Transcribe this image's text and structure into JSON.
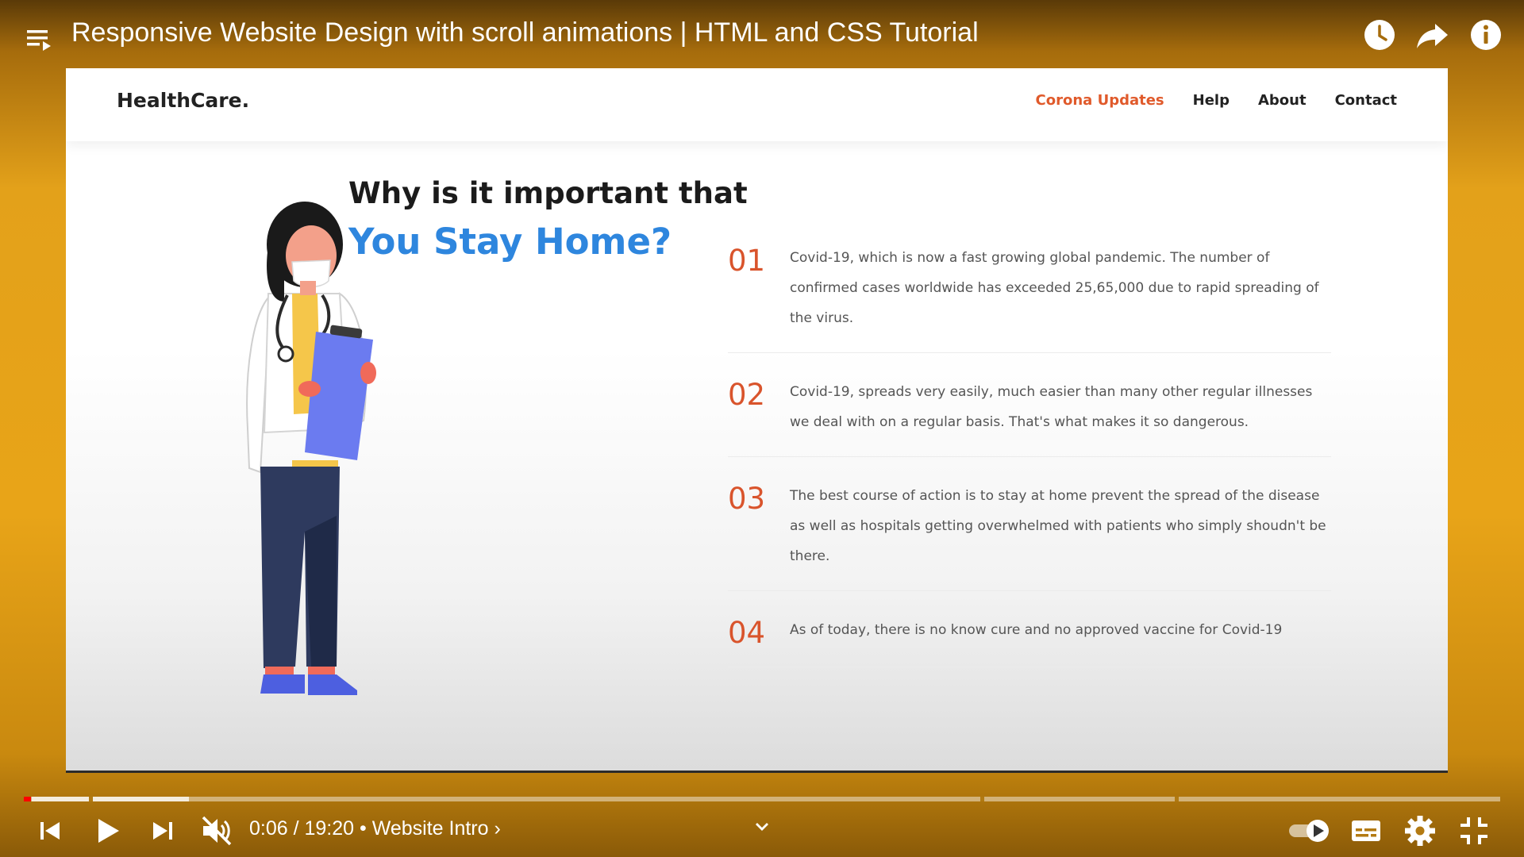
{
  "player": {
    "title": "Responsive Website Design with scroll animations | HTML and CSS Tutorial",
    "time_current": "0:06",
    "time_total": "19:20",
    "time_display": "0:06 / 19:20 • Website Intro ›",
    "chapter": "Website Intro",
    "progress_fraction": 0.005,
    "colors": {
      "accent": "#ff0000",
      "frame_bg": "#e8a418"
    },
    "icons": [
      "playlist-icon",
      "watch-later-icon",
      "share-icon",
      "info-icon",
      "previous-icon",
      "play-icon",
      "next-icon",
      "mute-icon",
      "chevron-down-icon",
      "autoplay-toggle-icon",
      "subtitles-icon",
      "settings-icon",
      "exit-fullscreen-icon"
    ]
  },
  "site": {
    "logo": "HealthCare.",
    "nav": [
      {
        "label": "Corona Updates",
        "active": true
      },
      {
        "label": "Help",
        "active": false
      },
      {
        "label": "About",
        "active": false
      },
      {
        "label": "Contact",
        "active": false
      }
    ],
    "heading_line1": "Why is it important that",
    "heading_line2": "You Stay Home?",
    "points": [
      {
        "num": "01",
        "text": "Covid-19, which is now a fast growing global pandemic. The number of confirmed cases worldwide has exceeded 25,65,000 due to rapid spreading of the virus."
      },
      {
        "num": "02",
        "text": "Covid-19, spreads very easily, much easier than many other regular illnesses we deal with on a regular basis. That's what makes it so dangerous."
      },
      {
        "num": "03",
        "text": "The best course of action is to stay at home prevent the spread of the disease as well as hospitals getting overwhelmed with patients who simply shoudn't be there."
      },
      {
        "num": "04",
        "text": "As of today, there is no know cure and no approved vaccine for Covid-19"
      }
    ],
    "colors": {
      "accent": "#e05a2b",
      "heading_blue": "#2e86de"
    }
  }
}
